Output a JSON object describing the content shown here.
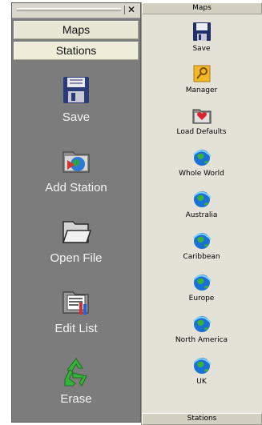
{
  "left_panel": {
    "groups": [
      "Maps",
      "Stations"
    ],
    "buttons": [
      {
        "label": "Save",
        "icon": "floppy-disk-icon"
      },
      {
        "label": "Add Station",
        "icon": "folder-globe-icon"
      },
      {
        "label": "Open File",
        "icon": "open-folder-icon"
      },
      {
        "label": "Edit List",
        "icon": "edit-list-icon"
      },
      {
        "label": "Erase",
        "icon": "recycle-icon"
      }
    ]
  },
  "right_panel": {
    "header": "Maps",
    "footer": "Stations",
    "items": [
      {
        "label": "Save",
        "icon": "floppy-disk-icon"
      },
      {
        "label": "Manager",
        "icon": "manager-icon"
      },
      {
        "label": "Load Defaults",
        "icon": "load-defaults-icon"
      },
      {
        "label": "Whole World",
        "icon": "globe-icon"
      },
      {
        "label": "Australia",
        "icon": "globe-icon"
      },
      {
        "label": "Caribbean",
        "icon": "globe-icon"
      },
      {
        "label": "Europe",
        "icon": "globe-icon"
      },
      {
        "label": "North America",
        "icon": "globe-icon"
      },
      {
        "label": "UK",
        "icon": "globe-icon"
      }
    ]
  }
}
